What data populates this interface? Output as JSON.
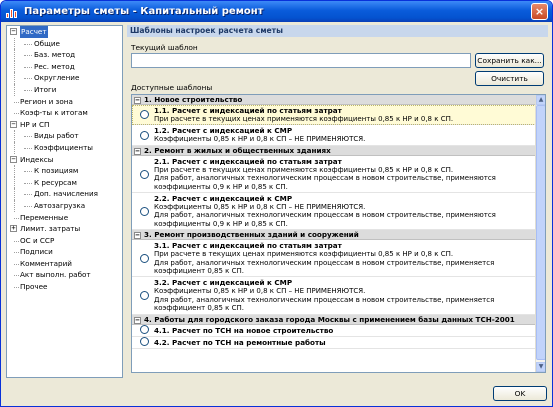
{
  "window": {
    "title": "Параметры сметы - Капитальный ремонт",
    "close_label": "×"
  },
  "tree": [
    {
      "label": "Расчет",
      "level": 0,
      "expander": "−",
      "selected": true
    },
    {
      "label": "Общие",
      "level": 1
    },
    {
      "label": "Баз. метод",
      "level": 1
    },
    {
      "label": "Рес. метод",
      "level": 1
    },
    {
      "label": "Округление",
      "level": 1
    },
    {
      "label": "Итоги",
      "level": 1
    },
    {
      "label": "Регион и зона",
      "level": 0
    },
    {
      "label": "Коэф-ты к итогам",
      "level": 0
    },
    {
      "label": "НР и СП",
      "level": 0,
      "expander": "−"
    },
    {
      "label": "Виды работ",
      "level": 1
    },
    {
      "label": "Коэффициенты",
      "level": 1
    },
    {
      "label": "Индексы",
      "level": 0,
      "expander": "−"
    },
    {
      "label": "К позициям",
      "level": 1
    },
    {
      "label": "К ресурсам",
      "level": 1
    },
    {
      "label": "Доп. начисления",
      "level": 1
    },
    {
      "label": "Автозагрузка",
      "level": 1
    },
    {
      "label": "Переменные",
      "level": 0
    },
    {
      "label": "Лимит. затраты",
      "level": 0,
      "expander": "+"
    },
    {
      "label": "ОС и ССР",
      "level": 0
    },
    {
      "label": "Подписи",
      "level": 0
    },
    {
      "label": "Комментарий",
      "level": 0
    },
    {
      "label": "Акт выполн. работ",
      "level": 0
    },
    {
      "label": "Прочее",
      "level": 0
    }
  ],
  "panel": {
    "header": "Шаблоны настроек расчета сметы",
    "current_label": "Текущий шаблон",
    "current_value": "",
    "save_button": "Сохранить как...",
    "clear_button": "Очистить",
    "available_label": "Доступные шаблоны"
  },
  "groups": [
    {
      "title": "1. Новое строительство",
      "items": [
        {
          "title": "1.1. Расчет с индексацией по статьям затрат",
          "desc": [
            "При расчете в текущих ценах применяются коэффициенты 0,85 к НР и 0,8 к СП."
          ],
          "selected": true
        },
        {
          "title": "1.2. Расчет с индексацией к СМР",
          "desc": [
            "Коэффициенты 0,85 к НР и 0,8 к СП – НЕ ПРИМЕНЯЮТСЯ."
          ]
        }
      ]
    },
    {
      "title": "2. Ремонт в жилых и общественных зданиях",
      "items": [
        {
          "title": "2.1. Расчет с индексацией по статьям затрат",
          "desc": [
            "При расчете в текущих ценах применяются коэффициенты 0,85 к НР и 0,8 к СП.",
            "Для работ, аналогичных технологическим процессам в новом строительстве, применяются",
            "коэффициенты 0,9 к НР и 0,85 к СП."
          ]
        },
        {
          "title": "2.2. Расчет с индексацией к СМР",
          "desc": [
            "Коэффициенты 0,85 к НР и 0,8 к СП – НЕ ПРИМЕНЯЮТСЯ.",
            "Для работ, аналогичных технологическим процессам в новом строительстве, применяются",
            "коэффициенты 0,9 к НР и 0,85 к СП."
          ]
        }
      ]
    },
    {
      "title": "3. Ремонт производственных зданий и сооружений",
      "items": [
        {
          "title": "3.1. Расчет с индексацией по статьям затрат",
          "desc": [
            "При расчете в текущих ценах применяются коэффициенты 0,85 к НР и 0,8 к СП.",
            "Для работ, аналогичных технологическим процессам в новом строительстве, применяется",
            "коэффициент 0,85 к СП."
          ]
        },
        {
          "title": "3.2. Расчет с индексацией к СМР",
          "desc": [
            "Коэффициенты 0,85 к НР и 0,8 к СП – НЕ ПРИМЕНЯЮТСЯ.",
            "Для работ, аналогичных технологическим процессам в новом строительстве, применяется",
            "коэффициент 0,85 к СП."
          ]
        }
      ]
    },
    {
      "title": "4. Работы для городского заказа города Москвы с применением базы данных ТСН-2001",
      "items": [
        {
          "title": "4.1. Расчет по ТСН на новое строительство",
          "desc": []
        },
        {
          "title": "4.2. Расчет по ТСН на ремонтные работы",
          "desc": []
        }
      ]
    }
  ],
  "footer": {
    "ok_button": "OK"
  },
  "colors": {
    "titlebar": "#0a5cdb",
    "selection": "#316ac5",
    "selected_item_bg": "#fffbd6",
    "group_header_bg": "#dcdcdc",
    "panel_header_bg": "#c8d7ec"
  },
  "icons": {
    "app": "chart-icon",
    "close": "close-icon",
    "expander": "tree-expander-icon",
    "radio": "radio-icon"
  }
}
